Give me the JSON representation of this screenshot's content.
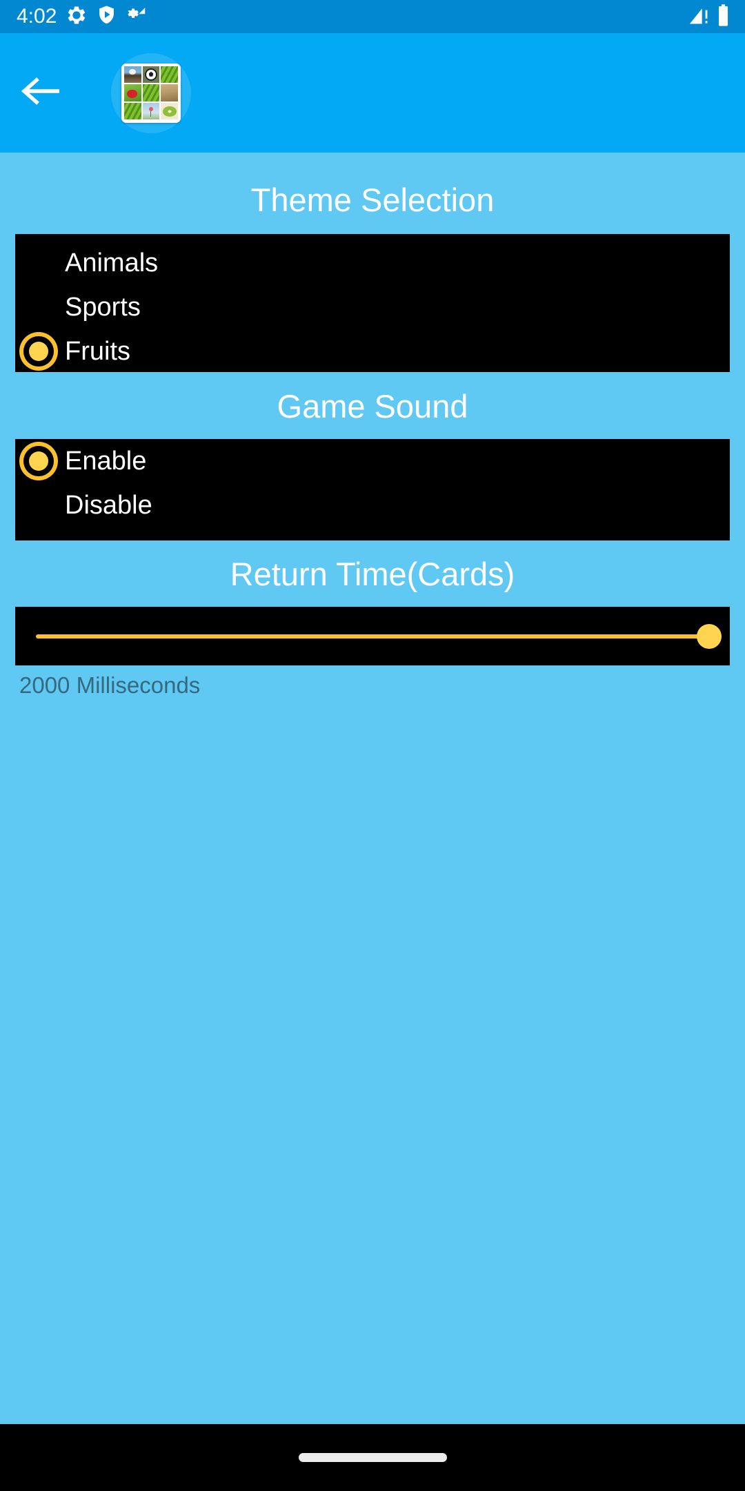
{
  "status_bar": {
    "time": "4:02",
    "left_icons": [
      "gear-icon",
      "shield-play-icon",
      "gear-signal-icon"
    ],
    "right_icons": [
      "signal-no-service-icon",
      "battery-full-icon"
    ],
    "background_color": "#0288D1"
  },
  "toolbar": {
    "back_label": "Back",
    "app_icon_name": "memory-game-grid-icon",
    "app_icon_tiles": [
      "eagle",
      "soccer-ball",
      "leaf",
      "strawberry",
      "leaf",
      "dog",
      "leaf",
      "flower",
      "kiwi"
    ],
    "background_color": "#03A9F4"
  },
  "theme": {
    "title": "Theme Selection",
    "options": [
      {
        "label": "Animals",
        "selected": false
      },
      {
        "label": "Sports",
        "selected": false
      },
      {
        "label": "Fruits",
        "selected": true
      }
    ]
  },
  "sound": {
    "title": "Game Sound",
    "options": [
      {
        "label": "Enable",
        "selected": true
      },
      {
        "label": "Disable",
        "selected": false
      }
    ]
  },
  "return_time": {
    "title": "Return Time(Cards)",
    "value_label": "2000 Milliseconds",
    "value": 2000,
    "percent": 100
  },
  "nav_bar": {
    "gesture_pill": "home-gesture-pill"
  },
  "colors": {
    "accent_yellow": "#FFD54F",
    "track_yellow": "#FBC02D",
    "page_background": "#5FC9F3",
    "panel_background": "#000000",
    "value_text": "#36697F"
  }
}
